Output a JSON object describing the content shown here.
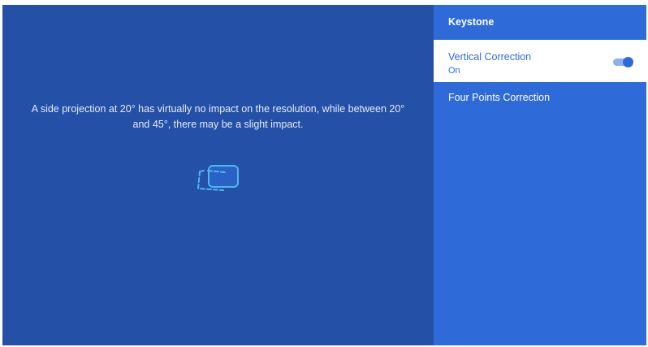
{
  "main": {
    "info_line1": "A side projection at 20° has virtually no impact on the resolution, while between 20°",
    "info_line2": "and 45°, there may be a slight impact.",
    "illustration_icon": "keystone-angle-icon"
  },
  "panel": {
    "title": "Keystone",
    "items": [
      {
        "label": "Vertical Correction",
        "value": "On",
        "toggle_on": true
      },
      {
        "label": "Four Points Correction"
      }
    ]
  },
  "colors": {
    "main_bg": "#2450a8",
    "panel_bg": "#2f6bd8",
    "selected_bg": "#ffffff",
    "accent": "#2f6bd8",
    "icon_accent": "#4fb6f0"
  }
}
